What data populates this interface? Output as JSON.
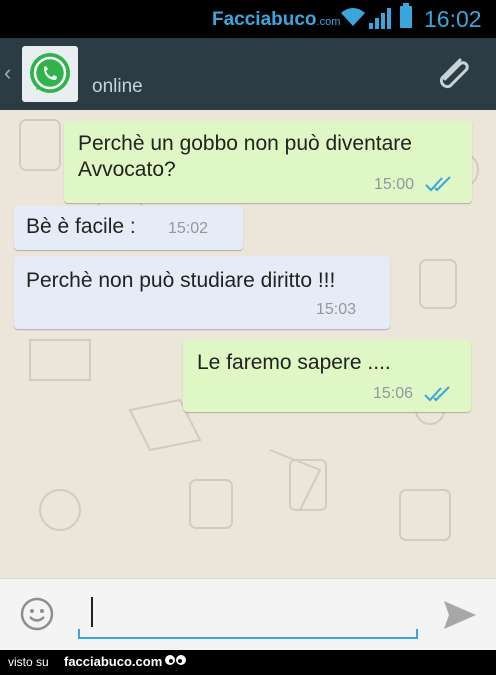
{
  "status_bar": {
    "brand": "Facciabuco",
    "brand_suffix": ".com",
    "time": "16:02",
    "icons": [
      "wifi-icon",
      "signal-icon",
      "battery-icon"
    ],
    "accent_color": "#3aa6dc"
  },
  "header": {
    "back_icon": "chevron-left-icon",
    "avatar_icon": "whatsapp-logo-icon",
    "contact_status": "online",
    "attach_icon": "paperclip-icon"
  },
  "messages": [
    {
      "direction": "out",
      "text_line1": "Perchè un gobbo non può diventare",
      "text_line2": "Avvocato?",
      "time": "15:00",
      "read": true
    },
    {
      "direction": "in",
      "text_line1": "Bè è facile :",
      "time": "15:02"
    },
    {
      "direction": "in",
      "text_line1": "Perchè non può studiare diritto !!!",
      "time": "15:03"
    },
    {
      "direction": "out",
      "text_line1": "Le faremo sapere ....",
      "time": "15:06",
      "read": true
    }
  ],
  "composer": {
    "value": "",
    "emoji_icon": "smiley-icon",
    "send_icon": "send-icon"
  },
  "footer": {
    "prefix": "visto su",
    "site": "facciabuco.com"
  },
  "colors": {
    "header_bg": "#2b3c45",
    "chat_bg": "#ece5da",
    "outgoing_bubble": "#dff7c4",
    "incoming_bubble": "#e6ecf7",
    "read_ticks": "#3aa6dc"
  }
}
